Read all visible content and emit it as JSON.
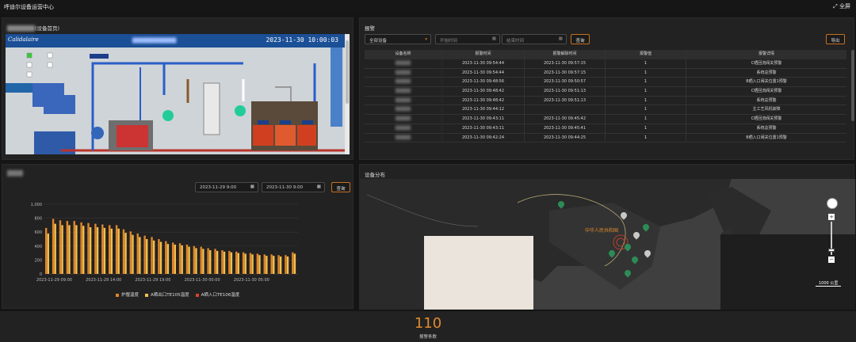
{
  "app": {
    "title": "呼迪尔设备运营中心",
    "fullscreen": "全屏"
  },
  "scada_panel": {
    "title": "(设备首页)",
    "logo": "Calidalaire",
    "time": "2023-11-30 10:00:03"
  },
  "alarm_panel": {
    "title": "报警",
    "device_select": "全部设备",
    "start_placeholder": "开始时间",
    "end_placeholder": "结束时间",
    "query": "查询",
    "export": "导出",
    "headers": [
      "设备名称",
      "报警时间",
      "报警解除时间",
      "报警值",
      "报警详情"
    ],
    "rows": [
      [
        "2023-11-30 09:54:44",
        "2023-11-30 09:57:15",
        "1",
        "C晒回流阀关预警"
      ],
      [
        "2023-11-30 09:54:44",
        "2023-11-30 09:57:15",
        "1",
        "系统总预警"
      ],
      [
        "2023-11-30 09:48:56",
        "2023-11-30 09:50:57",
        "1",
        "B晒入口阀关位置1预警"
      ],
      [
        "2023-11-30 09:48:42",
        "2023-11-30 09:51:13",
        "1",
        "C晒回流阀关预警"
      ],
      [
        "2023-11-30 09:48:42",
        "2023-11-30 09:51:13",
        "1",
        "系统总预警"
      ],
      [
        "2023-11-30 09:44:12",
        "",
        "1",
        "主工艺风机故障"
      ],
      [
        "2023-11-30 09:43:11",
        "2023-11-30 09:45:42",
        "1",
        "C晒回流阀关预警"
      ],
      [
        "2023-11-30 09:43:11",
        "2023-11-30 09:45:41",
        "1",
        "系统总预警"
      ],
      [
        "2023-11-30 09:42:24",
        "2023-11-30 09:44:25",
        "1",
        "B晒入口阀关位置1预警"
      ]
    ]
  },
  "chart_panel": {
    "start_date": "2023-11-29 9:00",
    "end_date": "2023-11-30 9:00",
    "query": "查询"
  },
  "chart_data": {
    "type": "bar",
    "ylim": [
      0,
      1000
    ],
    "y_ticks": [
      "1,000",
      "800",
      "600",
      "400",
      "200",
      "0"
    ],
    "x_ticks": [
      "2023-11-29 09:00",
      "2023-11-29 14:00",
      "2023-11-29 19:00",
      "2023-11-30 00:00",
      "2023-11-30 05:00"
    ],
    "series": [
      {
        "name": "炉膛温度",
        "color": "#e0852a",
        "values": [
          660,
          790,
          770,
          760,
          760,
          740,
          730,
          720,
          710,
          700,
          700,
          640,
          610,
          580,
          550,
          530,
          500,
          470,
          450,
          440,
          420,
          400,
          390,
          370,
          360,
          340,
          330,
          320,
          310,
          300,
          290,
          280,
          280,
          270,
          270,
          310
        ]
      },
      {
        "name": "A晒出口TE105温度",
        "color": "#f2c14e",
        "values": [
          580,
          720,
          700,
          700,
          700,
          690,
          670,
          670,
          660,
          650,
          650,
          590,
          560,
          530,
          500,
          480,
          460,
          430,
          420,
          410,
          390,
          370,
          360,
          340,
          330,
          320,
          310,
          300,
          290,
          280,
          270,
          260,
          260,
          250,
          250,
          290
        ]
      },
      {
        "name": "A晒入口TE106温度",
        "color": "#d9432a",
        "values": [
          0,
          0,
          0,
          0,
          0,
          0,
          0,
          0,
          0,
          0,
          0,
          0,
          0,
          0,
          0,
          0,
          0,
          0,
          0,
          0,
          0,
          0,
          0,
          0,
          0,
          0,
          0,
          0,
          0,
          0,
          0,
          0,
          0,
          0,
          0,
          0
        ]
      }
    ]
  },
  "map_panel": {
    "title": "设备分布",
    "scale": "1000 公里",
    "country": "中华人民共和国"
  },
  "summary": {
    "count": "110",
    "label": "报警条数"
  }
}
